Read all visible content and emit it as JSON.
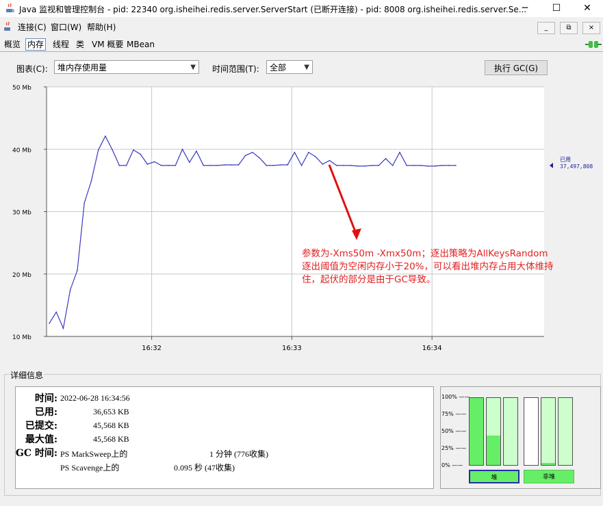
{
  "window": {
    "title": "Java 监视和管理控制台 - pid: 22340 org.isheihei.redis.server.ServerStart (已断开连接) - pid: 8008 org.isheihei.redis.server.Se...",
    "minimize": "─",
    "maximize": "☐",
    "close": "✕"
  },
  "menu": {
    "items": [
      "连接(C)",
      "窗口(W)",
      "帮助(H)"
    ],
    "inner_buttons": [
      "_",
      "⧉",
      "×"
    ]
  },
  "tabs": [
    "概览",
    "内存",
    "线程",
    "类",
    "VM 概要",
    "MBean"
  ],
  "active_tab": "内存",
  "controls": {
    "chart_label": "图表(C):",
    "chart_value": "堆内存使用量",
    "range_label": "时间范围(T):",
    "range_value": "全部",
    "gc_button": "执行 GC(G)"
  },
  "chart_data": {
    "type": "line",
    "series": [
      {
        "name": "已用",
        "x_minutes": [
          0.0,
          0.05,
          0.1,
          0.15,
          0.2,
          0.25,
          0.3,
          0.35,
          0.4,
          0.45,
          0.5,
          0.55,
          0.6,
          0.65,
          0.7,
          0.75,
          0.8,
          0.85,
          0.9,
          0.95,
          1.0,
          1.05,
          1.1,
          1.15,
          1.2,
          1.25,
          1.3,
          1.35,
          1.4,
          1.45,
          1.5,
          1.55,
          1.6,
          1.65,
          1.7,
          1.75,
          1.8,
          1.85,
          1.9,
          1.95,
          2.0,
          2.05,
          2.1,
          2.15,
          2.2,
          2.25,
          2.3,
          2.35,
          2.4,
          2.45,
          2.5,
          2.55,
          2.6,
          2.65,
          2.7,
          2.75,
          2.8,
          2.85,
          2.9,
          2.95,
          3.0,
          3.05,
          3.1,
          3.15,
          3.2
        ],
        "values": [
          12.1,
          13.9,
          11.3,
          17.5,
          20.6,
          31.4,
          34.9,
          39.9,
          42.1,
          39.9,
          37.4,
          37.4,
          39.9,
          39.2,
          37.6,
          38.0,
          37.4,
          37.4,
          37.4,
          40.0,
          37.9,
          39.7,
          37.4,
          37.4,
          37.4,
          37.5,
          37.5,
          37.5,
          39.0,
          39.5,
          38.6,
          37.4,
          37.4,
          37.5,
          37.5,
          39.5,
          37.4,
          39.5,
          38.8,
          37.6,
          38.2,
          37.4,
          37.4,
          37.4,
          37.3,
          37.3,
          37.4,
          37.4,
          38.5,
          37.4,
          39.5,
          37.4,
          37.4,
          37.4,
          37.3,
          37.3,
          37.4,
          37.4,
          37.4
        ]
      }
    ],
    "ylim": [
      10,
      50
    ],
    "yticks": [
      "50 Mb",
      "40 Mb",
      "30 Mb",
      "20 Mb",
      "10 Mb"
    ],
    "xticks": [
      "16:32",
      "16:33",
      "16:34"
    ],
    "grid": true,
    "legend_label": "已用",
    "legend_value": "37,497,808"
  },
  "annotation": {
    "lines": [
      "参数为-Xms50m -Xmx50m；逐出策略为AllKeysRandom",
      "逐出阈值为空闲内存小于20%，可以看出堆内存占用大体维持",
      "住，起伏的部分是由于GC导致。"
    ]
  },
  "details": {
    "legend": "详细信息",
    "time_label": "时间:",
    "time_value": "2022-06-28 16:34:56",
    "used_label": "已用:",
    "used_value": "36,653 KB",
    "committed_label": "已提交:",
    "committed_value": "45,568 KB",
    "max_label": "最大值:",
    "max_value": "45,568 KB",
    "gc_label": "GC 时间:",
    "gc1_name": "PS MarkSweep上的",
    "gc1_value": "1 分钟 (776收集)",
    "gc2_name": "PS Scavenge上的",
    "gc2_value": "0.095 秒 (47收集)"
  },
  "gauges": {
    "ticks": [
      "100% ——",
      "75% ——",
      "50% ——",
      "25% ——",
      "0% ——"
    ],
    "heap_label": "堆",
    "nonheap_label": "非堆",
    "heap_bars": [
      {
        "committed": 1.0,
        "used": 1.0
      },
      {
        "committed": 1.0,
        "used": 0.44
      },
      {
        "committed": 1.0,
        "used": 0.0
      }
    ],
    "nonheap_bars": [
      {
        "committed": 0.0,
        "used": 0.0
      },
      {
        "committed": 1.0,
        "used": 0.03
      },
      {
        "committed": 1.0,
        "used": 0.0
      }
    ],
    "bar_color_used": "#66ee66",
    "bar_color_committed": "#ccffcc"
  }
}
